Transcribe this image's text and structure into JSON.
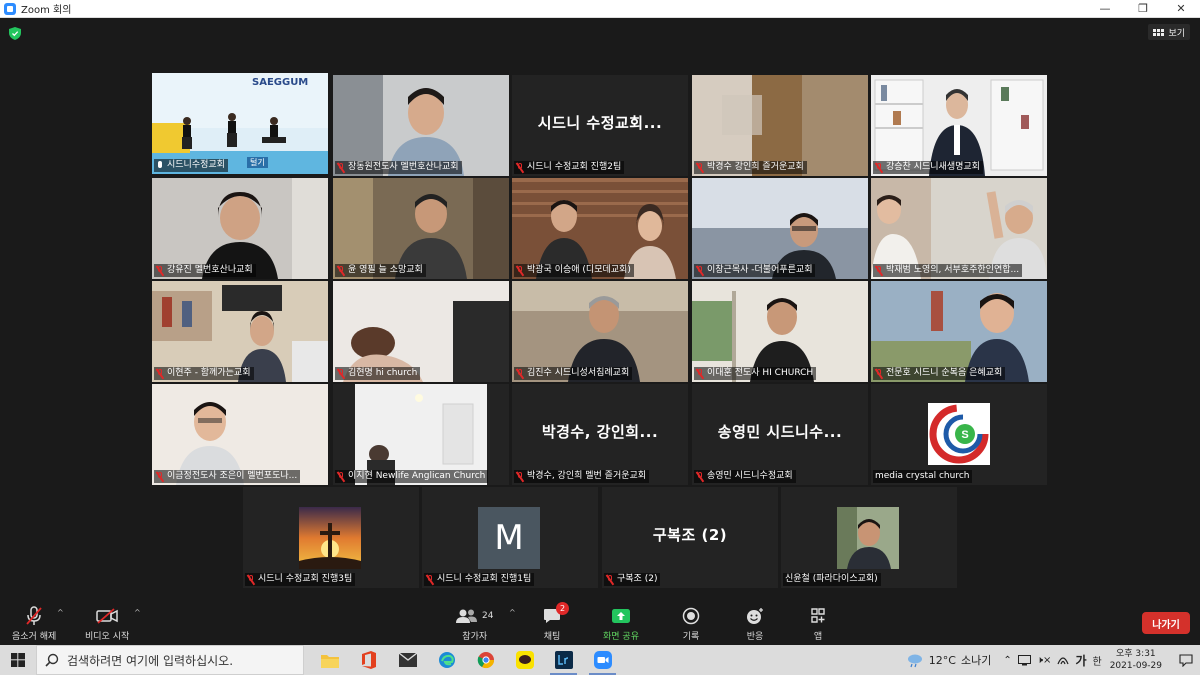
{
  "window": {
    "title": "Zoom 회의",
    "minimize": "—",
    "maximize": "❐",
    "close": "✕"
  },
  "header": {
    "view_label": "보기"
  },
  "tiles": [
    {
      "id": "t1",
      "label": "시드니수정교회",
      "overlay": "",
      "mic": "on"
    },
    {
      "id": "t2",
      "label": "장동원전도사 멜번호산나교회",
      "overlay": "",
      "mic": "off"
    },
    {
      "id": "t3",
      "label": "시드니 수정교회 진행2팀",
      "overlay": "시드니 수정교회...",
      "mic": "off"
    },
    {
      "id": "t4",
      "label": "박경수 강인희 즐거운교회",
      "overlay": "",
      "mic": "off"
    },
    {
      "id": "t5",
      "label": "강승찬 시드니새생명교회",
      "overlay": "",
      "mic": "off"
    },
    {
      "id": "t6",
      "label": "강유진 멜번호산나교회",
      "overlay": "",
      "mic": "off"
    },
    {
      "id": "t7",
      "label": "윤 영필 늘 소망교회",
      "overlay": "",
      "mic": "off"
    },
    {
      "id": "t8",
      "label": "박광국 이승애 (디모데교회)",
      "overlay": "",
      "mic": "off"
    },
    {
      "id": "t9",
      "label": "이창근목사 -더불어푸른교회",
      "overlay": "",
      "mic": "off"
    },
    {
      "id": "t10",
      "label": "박재범 노영의, 서부호주한인연합...",
      "overlay": "",
      "mic": "off"
    },
    {
      "id": "t11",
      "label": "이현주 - 함께가는교회",
      "overlay": "",
      "mic": "off"
    },
    {
      "id": "t12",
      "label": "김현명 hi church",
      "overlay": "",
      "mic": "off"
    },
    {
      "id": "t13",
      "label": "김진수 시드니성서침례교회",
      "overlay": "",
      "mic": "off"
    },
    {
      "id": "t14",
      "label": "이대훈 전도사 HI CHURCH",
      "overlay": "",
      "mic": "off"
    },
    {
      "id": "t15",
      "label": "전문호 시드니 순복음 은혜교회",
      "overlay": "",
      "mic": "off"
    },
    {
      "id": "t16",
      "label": "이금정전도사 조은이 멜번포도나...",
      "overlay": "",
      "mic": "off"
    },
    {
      "id": "t17",
      "label": "이지현 Newlife Anglican Church",
      "overlay": "",
      "mic": "off"
    },
    {
      "id": "t18",
      "label": "박경수, 강인희 멜번 즐거운교회",
      "overlay": "박경수, 강인희...",
      "mic": "off"
    },
    {
      "id": "t19",
      "label": "송영민 시드니수정교회",
      "overlay": "송영민 시드니수...",
      "mic": "off"
    },
    {
      "id": "t20",
      "label": "media crystal church",
      "overlay": "",
      "mic": "none"
    },
    {
      "id": "t21",
      "label": "시드니 수정교회 진행3팀",
      "overlay": "",
      "mic": "off"
    },
    {
      "id": "t22",
      "label": "시드니 수정교회 진행1팀",
      "overlay": "",
      "mic": "off"
    },
    {
      "id": "t23",
      "label": "구복조 (2)",
      "overlay": "구복조 (2)",
      "mic": "off"
    },
    {
      "id": "t24",
      "label": "신윤철 (파라다이스교회)",
      "overlay": "",
      "mic": "none"
    }
  ],
  "video_text": {
    "saeggum": "SAEGGUM",
    "caption": "털기"
  },
  "avatar_letter": "M",
  "controls": {
    "unmute": "음소거 해제",
    "start_video": "비디오 시작",
    "participants": "참가자",
    "participant_count": "24",
    "chat": "채팅",
    "chat_badge": "2",
    "share": "화면 공유",
    "record": "기록",
    "reactions": "반응",
    "apps": "앱",
    "leave": "나가기"
  },
  "taskbar": {
    "search_placeholder": "검색하려면 여기에 입력하십시오.",
    "weather_temp": "12°C",
    "weather_desc": "소나기",
    "ime": "가",
    "ime2": "한",
    "time": "오후 3:31",
    "date": "2021-09-29"
  },
  "colors": {
    "active_outline": "#f2e24a",
    "share_green": "#5fd15f",
    "leave_red": "#d4312b",
    "mic_off_red": "#e02828"
  }
}
